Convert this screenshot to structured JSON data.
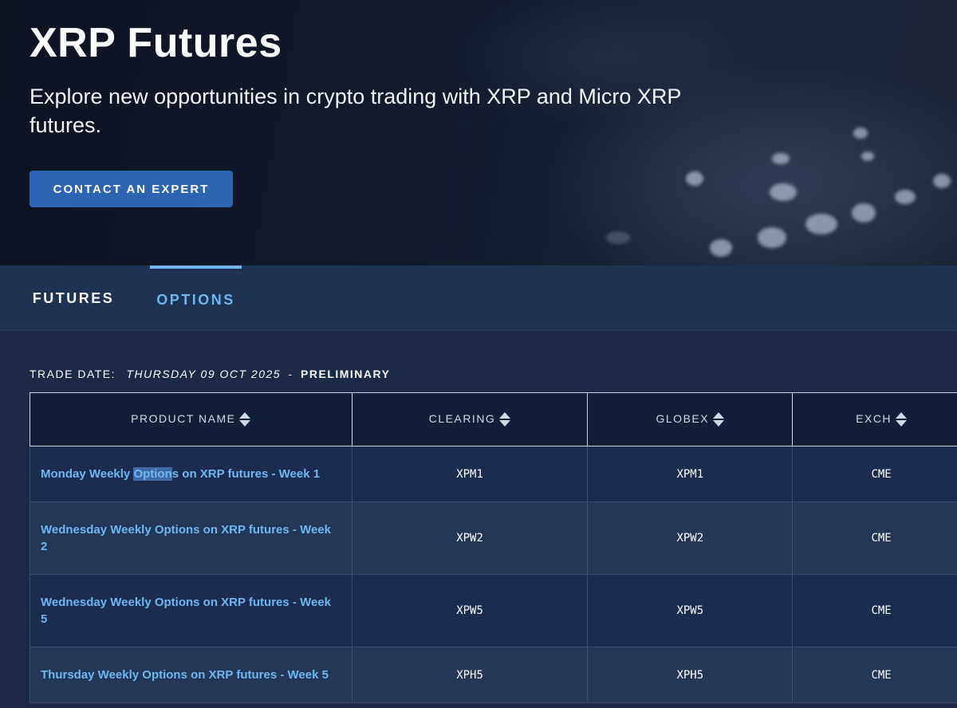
{
  "hero": {
    "title": "XRP Futures",
    "subtitle": "Explore new opportunities in crypto trading with XRP and Micro XRP futures.",
    "cta_label": "CONTACT AN EXPERT"
  },
  "tabs": [
    {
      "label": "FUTURES",
      "active": false
    },
    {
      "label": "OPTIONS",
      "active": true
    }
  ],
  "trade_date": {
    "label": "TRADE DATE:",
    "date": "THURSDAY 09 OCT 2025",
    "separator": "-",
    "status": "PRELIMINARY"
  },
  "table": {
    "columns": [
      "PRODUCT NAME",
      "CLEARING",
      "GLOBEX",
      "EXCH"
    ],
    "rows": [
      {
        "name_pre": "Monday Weekly ",
        "name_hl": "Option",
        "name_post": "s on XRP futures - Week 1",
        "clearing": "XPM1",
        "globex": "XPM1",
        "exch": "CME"
      },
      {
        "name": "Wednesday Weekly Options on XRP futures - Week 2",
        "clearing": "XPW2",
        "globex": "XPW2",
        "exch": "CME"
      },
      {
        "name": "Wednesday Weekly Options on XRP futures - Week 5",
        "clearing": "XPW5",
        "globex": "XPW5",
        "exch": "CME"
      },
      {
        "name": "Thursday Weekly Options on XRP futures - Week 5",
        "clearing": "XPH5",
        "globex": "XPH5",
        "exch": "CME"
      }
    ]
  },
  "colors": {
    "accent_blue": "#6fb6f0",
    "cta_blue": "#2e63b2",
    "background": "#1b2a48"
  }
}
